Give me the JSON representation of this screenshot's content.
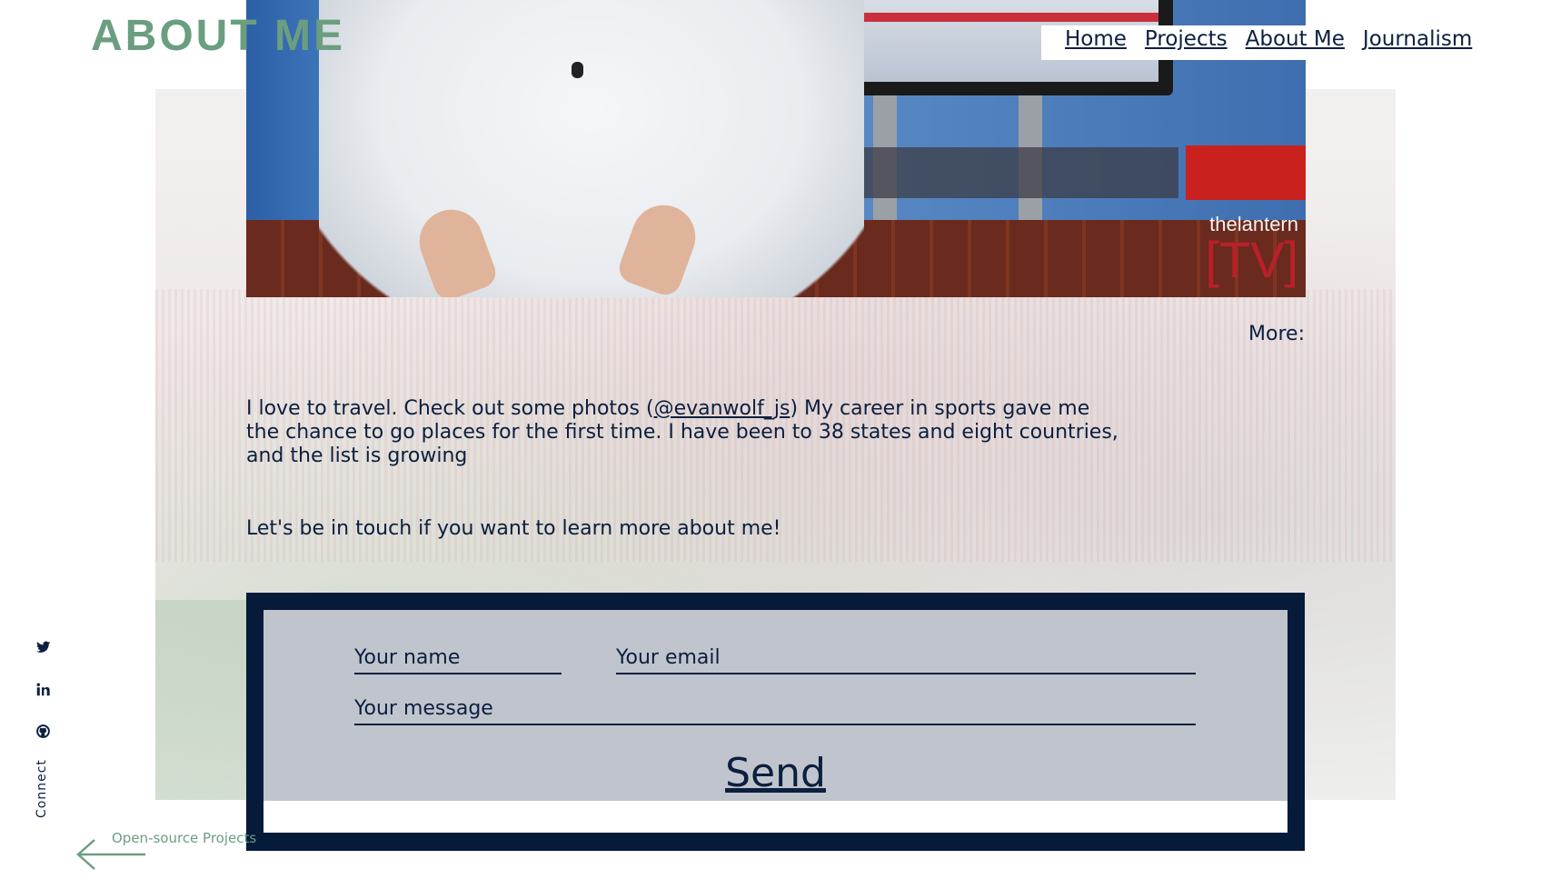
{
  "header": {
    "title": "ABOUT ME",
    "nav": [
      "Home",
      "Projects",
      "About Me",
      "Journalism"
    ]
  },
  "video": {
    "logo_top": "thelantern",
    "logo_bottom": "[TV]"
  },
  "content": {
    "more_label": "More:",
    "travel_text_before": "I love to travel. Check out some photos (",
    "travel_link": "@evanwolf_js",
    "travel_text_after": ") My career in sports gave me the chance to go places for the first time. I have been to 38 states and eight countries, and the list is growing",
    "touch_text": "Let's be in touch if you want to learn more about me!"
  },
  "form": {
    "name_placeholder": "Your name",
    "email_placeholder": "Your email",
    "message_placeholder": "Your message",
    "send_label": "Send"
  },
  "sidebar": {
    "connect_label": "Connect",
    "icons": [
      "twitter-icon",
      "linkedin-icon",
      "github-icon"
    ]
  },
  "footer": {
    "back_label": "Open-source Projects"
  },
  "colors": {
    "accent": "#6b9e80",
    "navy": "#0c1f3f",
    "form_border": "#061a3a"
  }
}
